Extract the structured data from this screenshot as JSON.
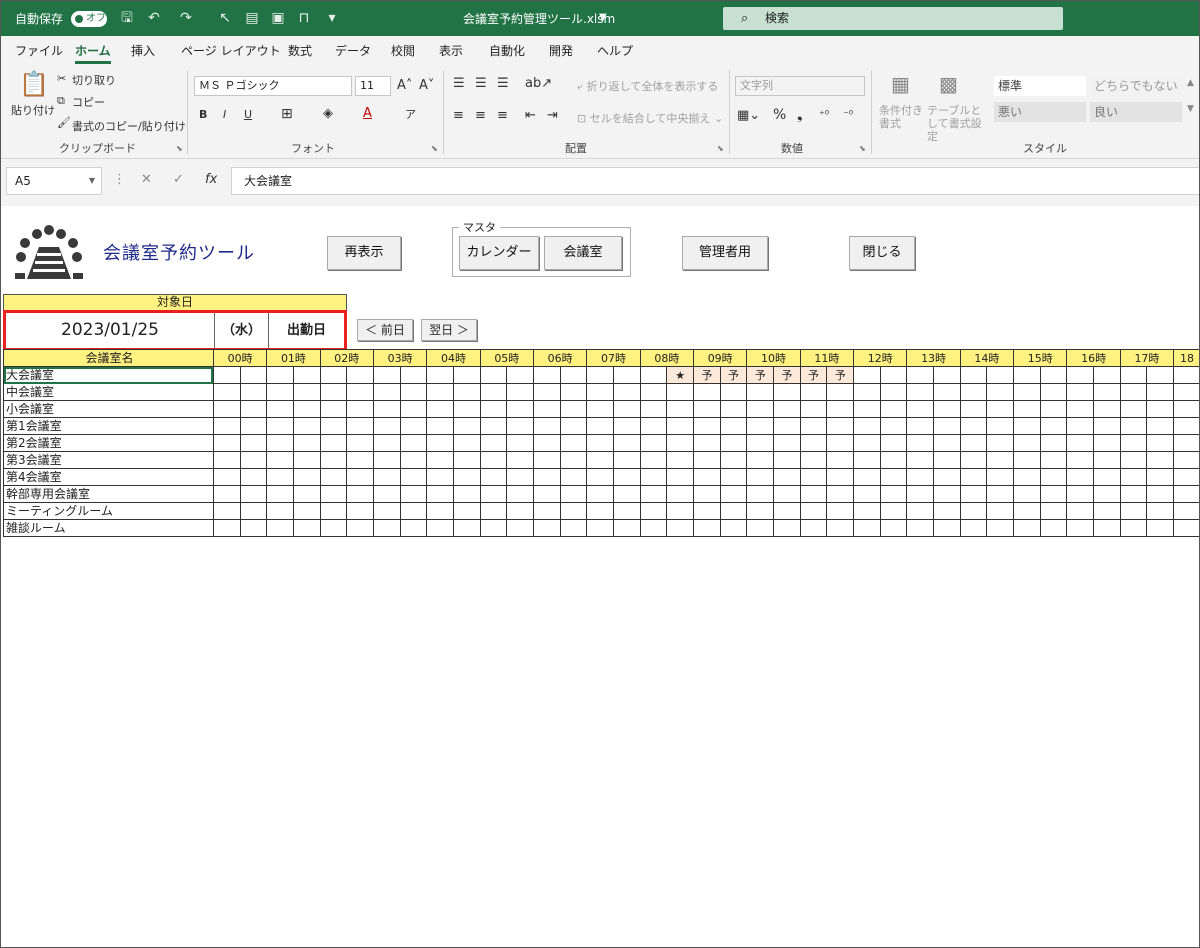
{
  "titlebar": {
    "autosave_label": "自動保存",
    "autosave_state": "オフ",
    "filename": "会議室予約管理ツール.xlsm",
    "search_label": "検索"
  },
  "ribbon": {
    "tabs": [
      "ファイル",
      "ホーム",
      "挿入",
      "ページ レイアウト",
      "数式",
      "データ",
      "校閲",
      "表示",
      "自動化",
      "開発",
      "ヘルプ"
    ],
    "active_tab": "ホーム",
    "clipboard": {
      "paste": "貼り付け",
      "cut": "切り取り",
      "copy": "コピー",
      "format_painter": "書式のコピー/貼り付け",
      "group": "クリップボード"
    },
    "font": {
      "font_name": "ＭＳ Ｐゴシック",
      "font_size": "11",
      "group": "フォント"
    },
    "alignment": {
      "wrap": "折り返して全体を表示する",
      "merge": "セルを結合して中央揃え",
      "group": "配置"
    },
    "number": {
      "format": "文字列",
      "group": "数値"
    },
    "styles": {
      "conditional": "条件付き書式",
      "table": "テーブルとして書式設定",
      "standard": "標準",
      "neutral": "どちらでもない",
      "bad": "悪い",
      "good": "良い",
      "group": "スタイル"
    }
  },
  "formula_bar": {
    "name_box": "A5",
    "fx": "fx",
    "content": "大会議室"
  },
  "sheet": {
    "app_title": "会議室予約ツール",
    "buttons": {
      "refresh": "再表示",
      "master_label": "マスタ",
      "calendar": "カレンダー",
      "rooms": "会議室",
      "admin": "管理者用",
      "close": "閉じる"
    },
    "date_header": "対象日",
    "date": "2023/01/25",
    "day_of_week": "（水）",
    "day_type": "出勤日",
    "prev_day": "＜ 前日",
    "next_day": "翌日 ＞",
    "grid": {
      "room_header": "会議室名",
      "hours": [
        "00時",
        "01時",
        "02時",
        "03時",
        "04時",
        "05時",
        "06時",
        "07時",
        "08時",
        "09時",
        "10時",
        "11時",
        "12時",
        "13時",
        "14時",
        "15時",
        "16時",
        "17時",
        "18"
      ],
      "rooms": [
        "大会議室",
        "中会議室",
        "小会議室",
        "第1会議室",
        "第2会議室",
        "第3会議室",
        "第4会議室",
        "幹部専用会議室",
        "ミーティングルーム",
        "雑談ルーム"
      ],
      "bookings": [
        {
          "room_index": 0,
          "slot": 17,
          "mark": "★"
        },
        {
          "room_index": 0,
          "slot": 18,
          "mark": "予"
        },
        {
          "room_index": 0,
          "slot": 19,
          "mark": "予"
        },
        {
          "room_index": 0,
          "slot": 20,
          "mark": "予"
        },
        {
          "room_index": 0,
          "slot": 21,
          "mark": "予"
        },
        {
          "room_index": 0,
          "slot": 22,
          "mark": "予"
        },
        {
          "room_index": 0,
          "slot": 23,
          "mark": "予"
        }
      ],
      "selected_room_index": 0
    }
  }
}
